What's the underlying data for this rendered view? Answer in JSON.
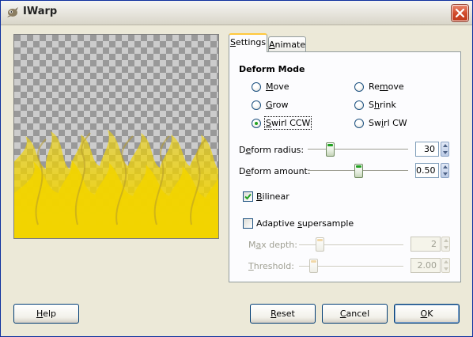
{
  "window": {
    "title": "IWarp",
    "icon": "gimp-icon",
    "close_icon": "close-icon"
  },
  "preview": {
    "description_icon": "flame-preview-image",
    "colors": {
      "flame": "#f2d400",
      "checker_dark": "#999999",
      "checker_light": "#cccccc"
    }
  },
  "tabs": [
    {
      "label": "Settings",
      "mnemonic_index": 0,
      "active": true
    },
    {
      "label": "Animate",
      "mnemonic_index": 0,
      "active": false
    }
  ],
  "deform_mode": {
    "title": "Deform Mode",
    "options": [
      {
        "label": "Move",
        "mnemonic_index": 0,
        "checked": false
      },
      {
        "label": "Grow",
        "mnemonic_index": 0,
        "checked": false
      },
      {
        "label": "Swirl CCW",
        "mnemonic_index": 0,
        "checked": true
      },
      {
        "label": "Remove",
        "mnemonic_index": 2,
        "checked": false
      },
      {
        "label": "Shrink",
        "mnemonic_index": 1,
        "checked": false
      },
      {
        "label": "Swirl CW",
        "mnemonic_index": 2,
        "checked": false
      }
    ]
  },
  "deform_radius": {
    "label": "Deform radius:",
    "mnemonic_index": 1,
    "value": "30",
    "slider_fraction": 0.22
  },
  "deform_amount": {
    "label": "Deform amount:",
    "mnemonic_index": 1,
    "value": "0.50",
    "slider_fraction": 0.5
  },
  "bilinear": {
    "label": "Bilinear",
    "mnemonic_index": 0,
    "checked": true
  },
  "adaptive": {
    "label": "Adaptive supersample",
    "mnemonic_index": 9,
    "checked": false,
    "max_depth": {
      "label": "Max depth:",
      "mnemonic_index": 1,
      "value": "2",
      "slider_fraction": 0.2
    },
    "threshold": {
      "label": "Threshold:",
      "mnemonic_index": 0,
      "value": "2.00",
      "slider_fraction": 0.14
    }
  },
  "buttons": {
    "help": {
      "label": "Help",
      "mnemonic_index": 0
    },
    "reset": {
      "label": "Reset",
      "mnemonic_index": 0
    },
    "cancel": {
      "label": "Cancel",
      "mnemonic_index": 0
    },
    "ok": {
      "label": "OK",
      "mnemonic_index": 0
    }
  }
}
